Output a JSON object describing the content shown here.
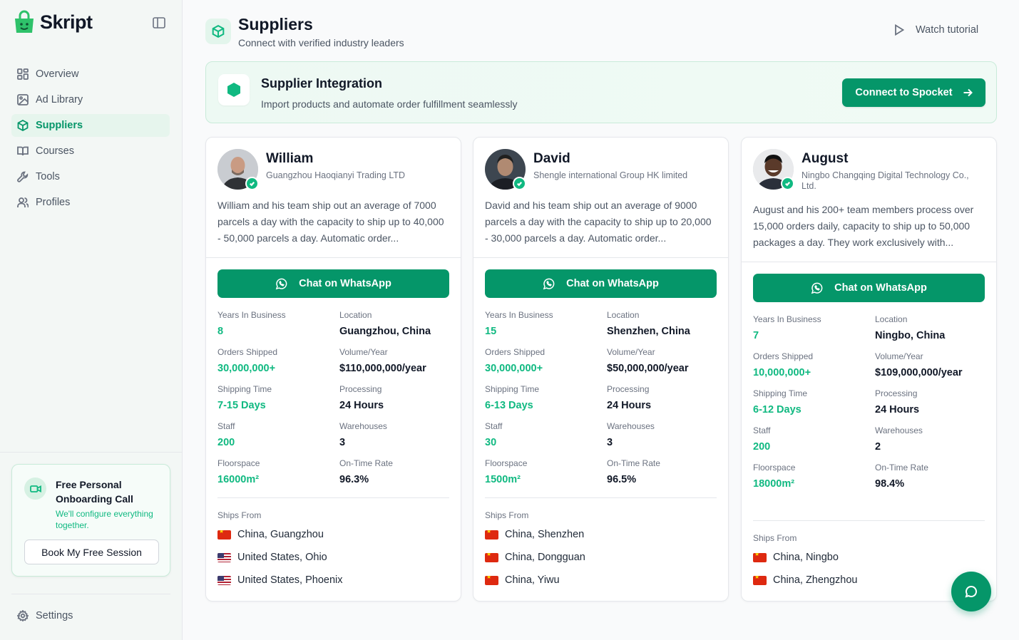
{
  "brand": {
    "name": "Skript"
  },
  "sidebar": {
    "items": [
      {
        "label": "Overview",
        "icon": "grid-icon",
        "active": false
      },
      {
        "label": "Ad Library",
        "icon": "image-icon",
        "active": false
      },
      {
        "label": "Suppliers",
        "icon": "box-icon",
        "active": true
      },
      {
        "label": "Courses",
        "icon": "book-icon",
        "active": false
      },
      {
        "label": "Tools",
        "icon": "wrench-icon",
        "active": false
      },
      {
        "label": "Profiles",
        "icon": "users-icon",
        "active": false
      }
    ],
    "onboarding": {
      "title": "Free Personal Onboarding Call",
      "subtitle": "We'll configure everything together.",
      "button": "Book My Free Session"
    },
    "settings_label": "Settings"
  },
  "header": {
    "title": "Suppliers",
    "subtitle": "Connect with verified industry leaders",
    "tutorial_label": "Watch tutorial"
  },
  "integration": {
    "title": "Supplier Integration",
    "subtitle": "Import products and automate order fulfillment seamlessly",
    "button": "Connect to Spocket"
  },
  "labels": {
    "whatsapp": "Chat on WhatsApp",
    "years": "Years In Business",
    "location": "Location",
    "orders": "Orders Shipped",
    "volume": "Volume/Year",
    "shipping": "Shipping Time",
    "processing": "Processing",
    "staff": "Staff",
    "warehouses": "Warehouses",
    "floorspace": "Floorspace",
    "ontime": "On-Time Rate",
    "ships_from": "Ships From"
  },
  "suppliers": [
    {
      "name": "William",
      "company": "Guangzhou Haoqianyi Trading LTD",
      "description": "William and his team ship out an average of 7000 parcels a day with the capacity to ship up to 40,000 - 50,000 parcels a day. Automatic order...",
      "years": "8",
      "location": "Guangzhou, China",
      "orders": "30,000,000+",
      "volume": "$110,000,000/year",
      "shipping": "7-15 Days",
      "processing": "24 Hours",
      "staff": "200",
      "warehouses": "3",
      "floorspace": "16000m²",
      "ontime": "96.3%",
      "ships_from": [
        {
          "flag": "cn",
          "label": "China, Guangzhou"
        },
        {
          "flag": "us",
          "label": "United States, Ohio"
        },
        {
          "flag": "us",
          "label": "United States, Phoenix"
        }
      ]
    },
    {
      "name": "David",
      "company": "Shengle international Group HK limited",
      "description": "David and his team ship out an average of 9000 parcels a day with the capacity to ship up to 20,000 - 30,000 parcels a day. Automatic order...",
      "years": "15",
      "location": "Shenzhen, China",
      "orders": "30,000,000+",
      "volume": "$50,000,000/year",
      "shipping": "6-13 Days",
      "processing": "24 Hours",
      "staff": "30",
      "warehouses": "3",
      "floorspace": "1500m²",
      "ontime": "96.5%",
      "ships_from": [
        {
          "flag": "cn",
          "label": "China, Shenzhen"
        },
        {
          "flag": "cn",
          "label": "China, Dongguan"
        },
        {
          "flag": "cn",
          "label": "China, Yiwu"
        }
      ]
    },
    {
      "name": "August",
      "company": "Ningbo Changqing Digital Technology Co., Ltd.",
      "description": "August and his 200+ team members process over 15,000 orders daily, capacity to ship up to 50,000 packages a day. They work exclusively with...",
      "years": "7",
      "location": "Ningbo, China",
      "orders": "10,000,000+",
      "volume": "$109,000,000/year",
      "shipping": "6-12 Days",
      "processing": "24 Hours",
      "staff": "200",
      "warehouses": "2",
      "floorspace": "18000m²",
      "ontime": "98.4%",
      "ships_from": [
        {
          "flag": "cn",
          "label": "China, Ningbo"
        },
        {
          "flag": "cn",
          "label": "China, Zhengzhou"
        }
      ]
    }
  ],
  "colors": {
    "accent": "#059669",
    "accent_light": "#10b981",
    "sidebar_bg": "#f3f7f5"
  }
}
